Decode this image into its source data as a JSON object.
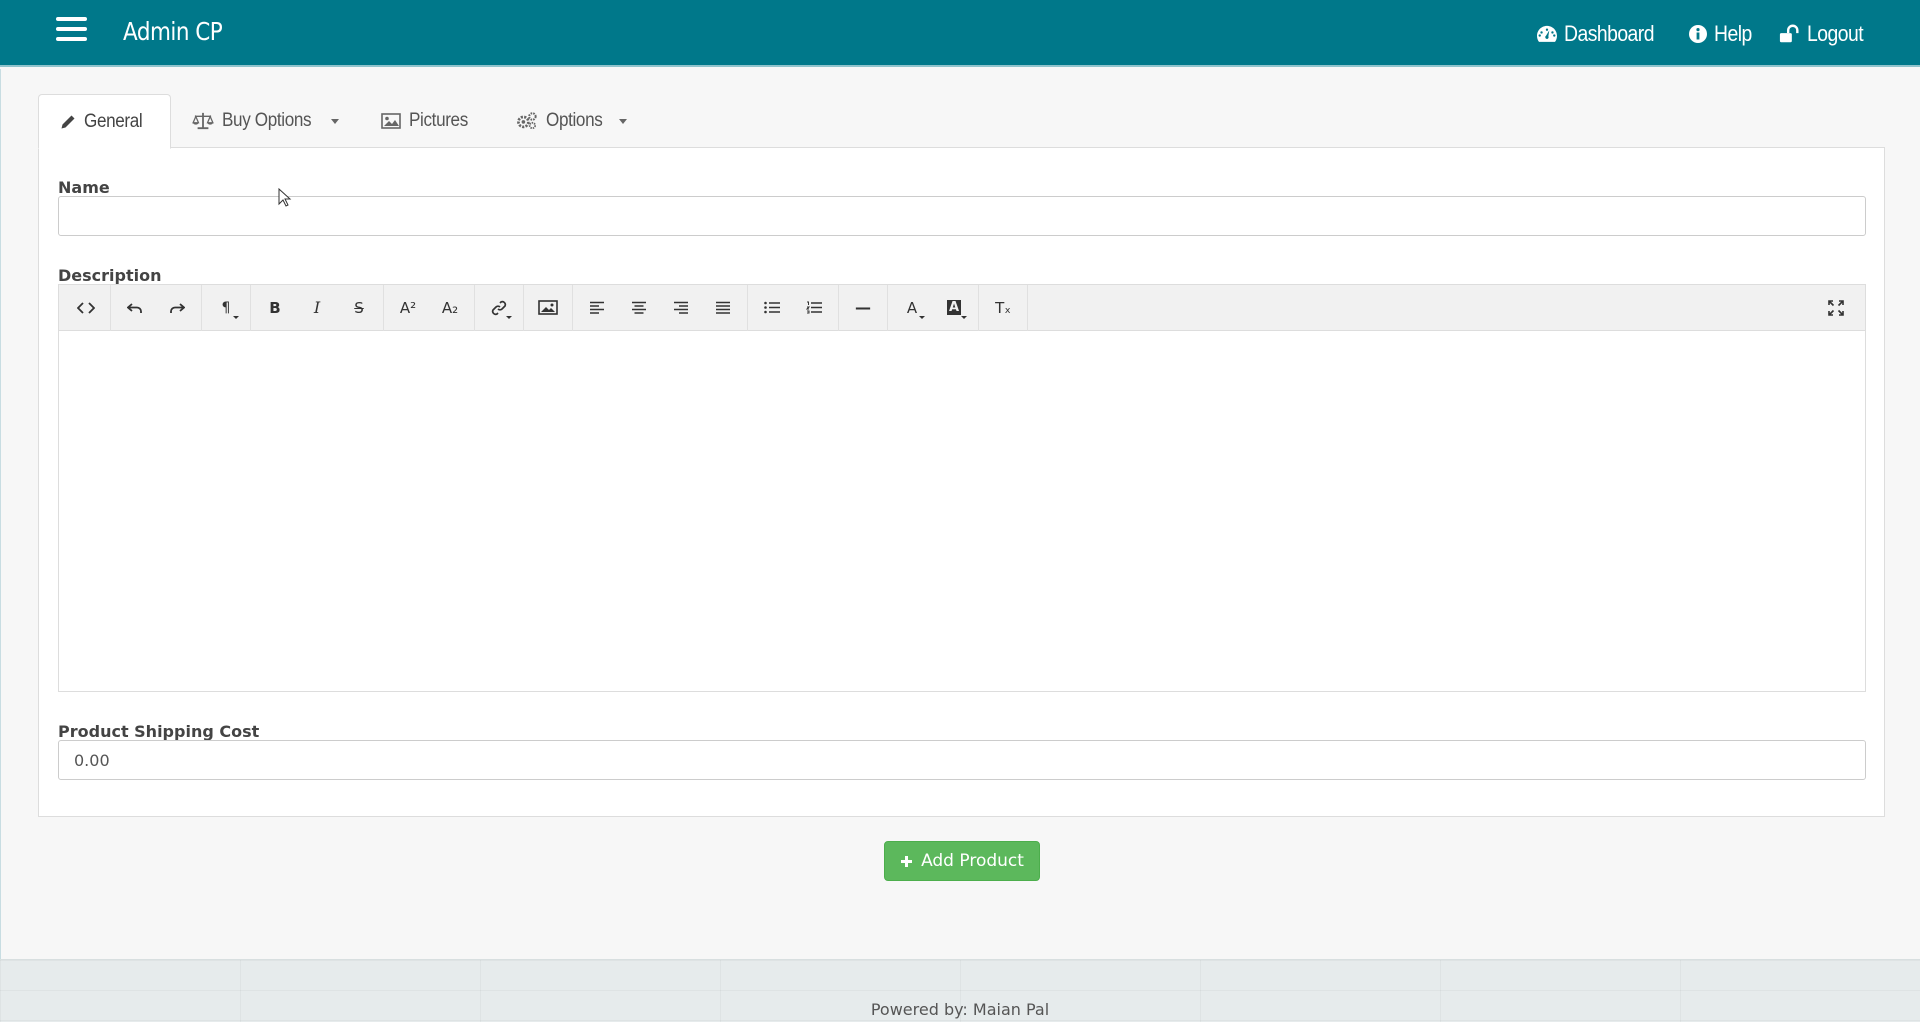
{
  "header": {
    "brand": "Admin CP",
    "links": [
      {
        "label": "Dashboard",
        "icon": "dashboard-icon"
      },
      {
        "label": "Help",
        "icon": "info-icon"
      },
      {
        "label": "Logout",
        "icon": "unlock-icon"
      }
    ]
  },
  "tabs": [
    {
      "label": "General",
      "icon": "pencil-icon",
      "active": true
    },
    {
      "label": "Buy Options",
      "icon": "balance-scale-icon",
      "dropdown": true
    },
    {
      "label": "Pictures",
      "icon": "image-icon"
    },
    {
      "label": "Options",
      "icon": "gears-icon",
      "dropdown": true
    }
  ],
  "form": {
    "name_label": "Name",
    "name_value": "",
    "description_label": "Description",
    "shipping_label": "Product Shipping Cost",
    "shipping_value": "0.00"
  },
  "editor_toolbar": {
    "paragraph": "¶",
    "bold": "B",
    "italic": "I",
    "strike": "S",
    "superscript": "A²",
    "subscript": "A₂",
    "hr": "—",
    "font_color": "A",
    "bg_color": "A",
    "clear_format": "Tₓ"
  },
  "submit": {
    "label": "Add Product"
  },
  "footer": {
    "text": "Powered by: Maian Pal"
  },
  "colors": {
    "header_bg": "#00788a",
    "success": "#5cb85c"
  }
}
